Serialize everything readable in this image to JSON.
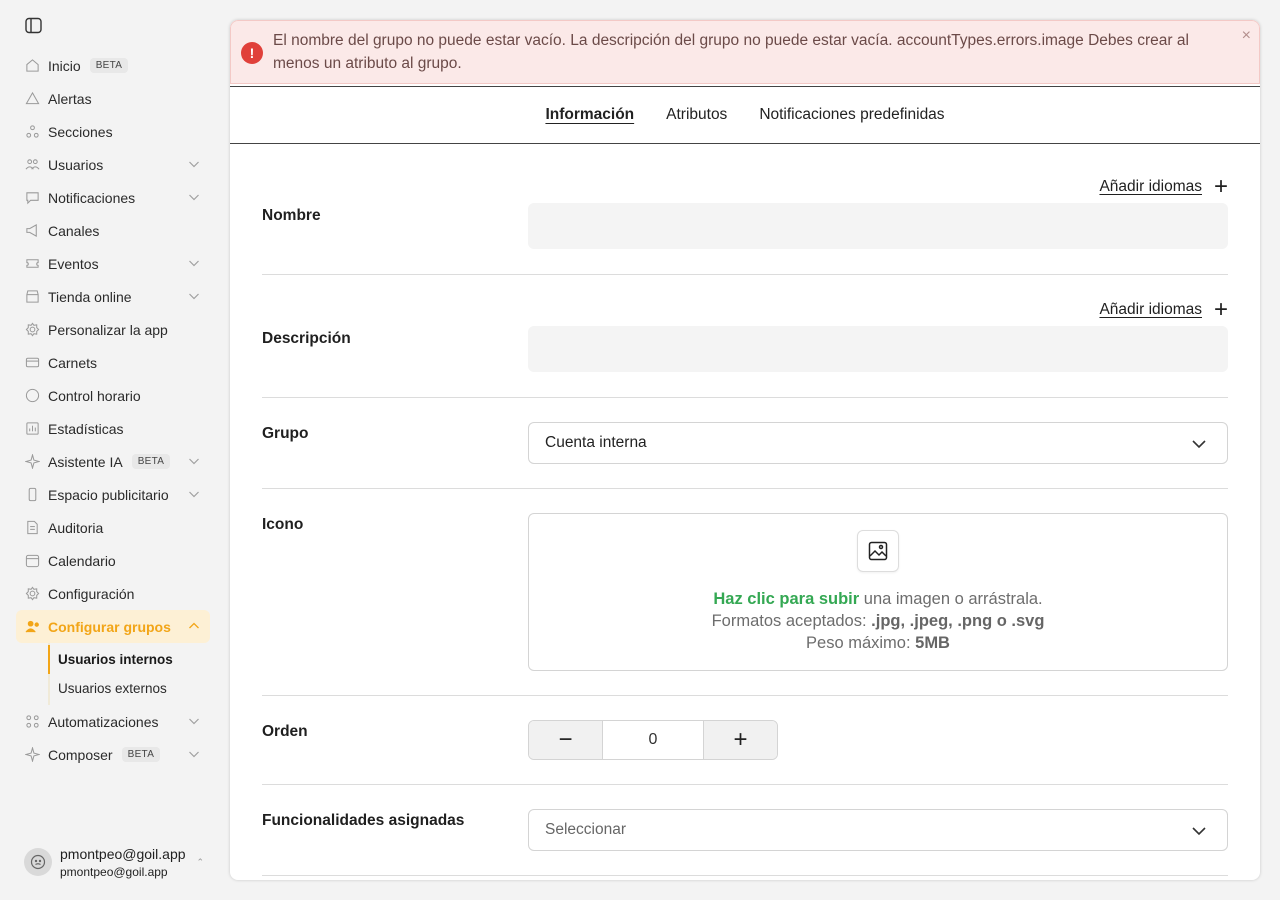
{
  "sidebar": {
    "items": [
      {
        "label": "Inicio",
        "icon": "home-icon",
        "badge": "BETA",
        "chevron": false
      },
      {
        "label": "Alertas",
        "icon": "alert-triangle-icon",
        "badge": "",
        "chevron": false
      },
      {
        "label": "Secciones",
        "icon": "sections-icon",
        "badge": "",
        "chevron": false
      },
      {
        "label": "Usuarios",
        "icon": "users-icon",
        "badge": "",
        "chevron": true
      },
      {
        "label": "Notificaciones",
        "icon": "chat-bubble-icon",
        "badge": "",
        "chevron": true
      },
      {
        "label": "Canales",
        "icon": "megaphone-icon",
        "badge": "",
        "chevron": false
      },
      {
        "label": "Eventos",
        "icon": "ticket-icon",
        "badge": "",
        "chevron": true
      },
      {
        "label": "Tienda online",
        "icon": "store-icon",
        "badge": "",
        "chevron": true
      },
      {
        "label": "Personalizar la app",
        "icon": "gear-icon",
        "badge": "",
        "chevron": false
      },
      {
        "label": "Carnets",
        "icon": "card-icon",
        "badge": "",
        "chevron": false
      },
      {
        "label": "Control horario",
        "icon": "clock-icon",
        "badge": "",
        "chevron": false
      },
      {
        "label": "Estadísticas",
        "icon": "chart-icon",
        "badge": "",
        "chevron": false
      },
      {
        "label": "Asistente IA",
        "icon": "sparkle-icon",
        "badge": "BETA",
        "chevron": true
      },
      {
        "label": "Espacio publicitario",
        "icon": "phone-icon",
        "badge": "",
        "chevron": true
      },
      {
        "label": "Auditoria",
        "icon": "document-icon",
        "badge": "",
        "chevron": false
      },
      {
        "label": "Calendario",
        "icon": "calendar-icon",
        "badge": "",
        "chevron": false
      },
      {
        "label": "Configuración",
        "icon": "gear-icon",
        "badge": "",
        "chevron": false
      },
      {
        "label": "Configurar grupos",
        "icon": "group-config-icon",
        "badge": "",
        "chevron": true,
        "active": true
      }
    ],
    "subitems": [
      "Usuarios internos",
      "Usuarios externos"
    ],
    "after_items": [
      {
        "label": "Automatizaciones",
        "icon": "automation-icon",
        "badge": "",
        "chevron": true
      },
      {
        "label": "Composer",
        "icon": "sparkle-icon",
        "badge": "BETA",
        "chevron": true
      }
    ],
    "user": {
      "name": "pmontpeo@goil.app",
      "email": "pmontpeo@goil.app"
    }
  },
  "alert": {
    "message": "El nombre del grupo no puede estar vacío. La descripción del grupo no puede estar vacía. accountTypes.errors.image Debes crear al menos un atributo al grupo.",
    "close": "×",
    "icon": "!"
  },
  "tabs": [
    "Información",
    "Atributos",
    "Notificaciones predefinidas"
  ],
  "form": {
    "add_languages": "Añadir idiomas",
    "plus": "+",
    "nombre_label": "Nombre",
    "descripcion_label": "Descripción",
    "grupo_label": "Grupo",
    "grupo_value": "Cuenta interna",
    "icono_label": "Icono",
    "upload": {
      "click": "Haz clic para subir",
      "rest": " una imagen o arrástrala.",
      "formats_prefix": "Formatos aceptados: ",
      "formats": ".jpg, .jpeg, .png o .svg",
      "size_prefix": "Peso máximo: ",
      "size": "5MB"
    },
    "orden_label": "Orden",
    "orden_value": "0",
    "minus": "−",
    "funcionalidades_label": "Funcionalidades asignadas",
    "funcionalidades_placeholder": "Seleccionar"
  },
  "colors": {
    "accent": "#f2a517",
    "error": "#e0403a",
    "success": "#34a853"
  }
}
